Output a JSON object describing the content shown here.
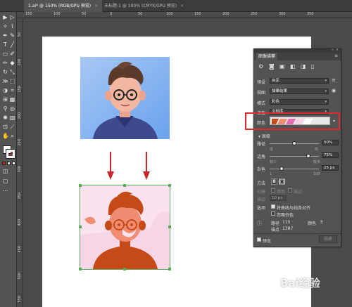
{
  "tabs": [
    {
      "label": "1.ai* @ 150% (RGB/GPU 预览)",
      "close": "×"
    },
    {
      "label": "未标题-1 @ 100% (CMYK/GPU 预览)",
      "close": "×"
    }
  ],
  "ruler_top": [
    "150",
    "100",
    "50",
    "0",
    "50",
    "100",
    "150",
    "200",
    "250",
    "300",
    "350"
  ],
  "ruler_left": [
    "50",
    "100",
    "150",
    "200",
    "250",
    "300",
    "350",
    "400",
    "450",
    "500",
    "550"
  ],
  "panel": {
    "title": "图像描摹",
    "preset_label": "预设",
    "preset_value": "自定",
    "view_label": "视图",
    "view_value": "描摹结果",
    "mode_label": "模式",
    "mode_value": "彩色",
    "palette_label": "调板",
    "palette_value": "文档库",
    "colors_label": "颜色",
    "advanced_label": "高级",
    "paths_label": "路径",
    "paths_value": "50%",
    "paths_low": "低",
    "paths_high": "高",
    "corners_label": "边角",
    "corners_value": "75%",
    "corners_low": "较少",
    "corners_high": "较多",
    "noise_label": "杂色",
    "noise_value": "25 px",
    "noise_min": "1",
    "noise_max": "100",
    "method_label": "方法",
    "create_label": "创建",
    "create_fill": "填色",
    "create_stroke": "描边",
    "stroke_label": "描边",
    "stroke_value": "10 px",
    "options_label": "选项",
    "option_snap": "将曲线与线条对齐",
    "option_ignore_white": "忽略白色",
    "paths_count_label": "路径",
    "paths_count": "115",
    "colors_count_label": "颜色",
    "colors_count": "5",
    "anchors_label": "锚点",
    "anchors_count": "1387",
    "preview_label": "预览",
    "trace_button": "描摹"
  },
  "watermark": "Bai经验",
  "colors": {
    "highlight_box": "#e0282e",
    "arrow": "#c8282c",
    "artboard": "#ffffff",
    "panel_bg": "#535353"
  }
}
